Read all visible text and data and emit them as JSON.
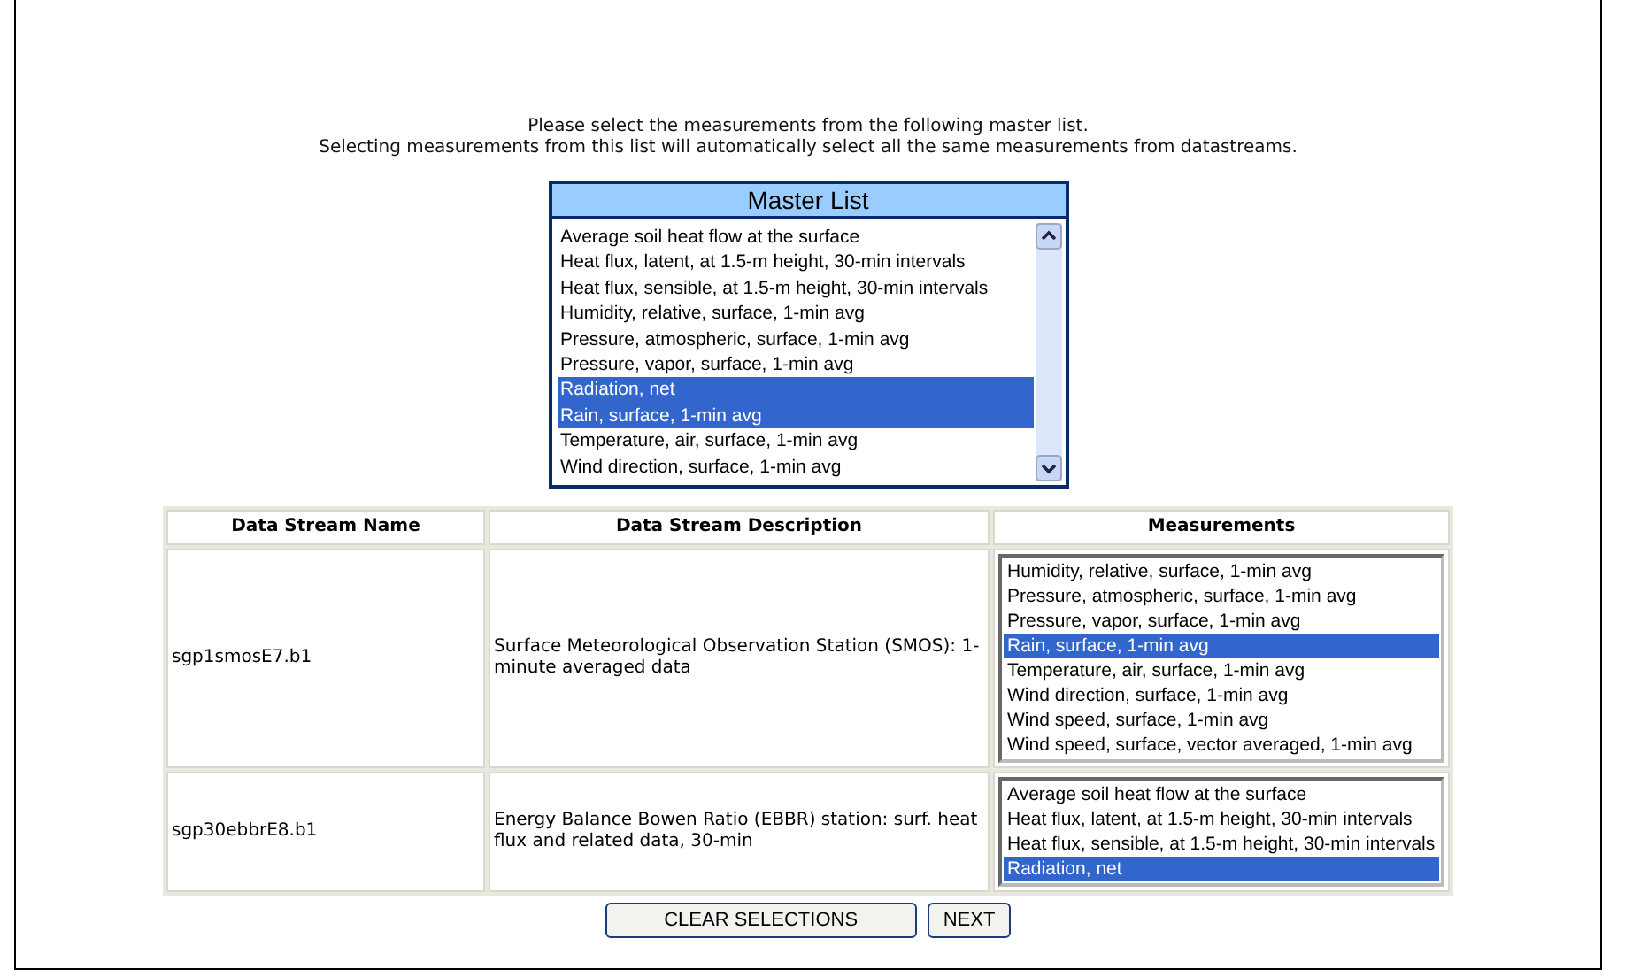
{
  "instructions": [
    "Please select the measurements from the following master list.",
    "Selecting measurements from this list will automatically select all the same measurements from datastreams."
  ],
  "master_list": {
    "title": "Master List",
    "items": [
      {
        "label": "Average soil heat flow at the surface",
        "selected": false
      },
      {
        "label": "Heat flux, latent, at 1.5-m height, 30-min intervals",
        "selected": false
      },
      {
        "label": "Heat flux, sensible, at 1.5-m height, 30-min intervals",
        "selected": false
      },
      {
        "label": "Humidity, relative, surface, 1-min avg",
        "selected": false
      },
      {
        "label": "Pressure, atmospheric, surface, 1-min avg",
        "selected": false
      },
      {
        "label": "Pressure, vapor, surface, 1-min avg",
        "selected": false
      },
      {
        "label": "Radiation, net",
        "selected": true
      },
      {
        "label": "Rain, surface, 1-min avg",
        "selected": true
      },
      {
        "label": "Temperature, air, surface, 1-min avg",
        "selected": false
      },
      {
        "label": "Wind direction, surface, 1-min avg",
        "selected": false
      }
    ]
  },
  "table": {
    "columns": [
      "Data Stream Name",
      "Data Stream Description",
      "Measurements"
    ],
    "rows": [
      {
        "name": "sgp1smosE7.b1",
        "description": "Surface Meteorological Observation Station (SMOS): 1-minute averaged data",
        "measurements": [
          {
            "label": "Humidity, relative, surface, 1-min avg",
            "selected": false
          },
          {
            "label": "Pressure, atmospheric, surface, 1-min avg",
            "selected": false
          },
          {
            "label": "Pressure, vapor, surface, 1-min avg",
            "selected": false
          },
          {
            "label": "Rain, surface, 1-min avg",
            "selected": true
          },
          {
            "label": "Temperature, air, surface, 1-min avg",
            "selected": false
          },
          {
            "label": "Wind direction, surface, 1-min avg",
            "selected": false
          },
          {
            "label": "Wind speed, surface, 1-min avg",
            "selected": false
          },
          {
            "label": "Wind speed, surface, vector averaged, 1-min avg",
            "selected": false
          }
        ]
      },
      {
        "name": "sgp30ebbrE8.b1",
        "description": "Energy Balance Bowen Ratio (EBBR) station: surf. heat flux and related data, 30-min",
        "measurements": [
          {
            "label": "Average soil heat flow at the surface",
            "selected": false
          },
          {
            "label": "Heat flux, latent, at 1.5-m height, 30-min intervals",
            "selected": false
          },
          {
            "label": "Heat flux, sensible, at 1.5-m height, 30-min intervals",
            "selected": false
          },
          {
            "label": "Radiation, net",
            "selected": true
          }
        ]
      }
    ]
  },
  "buttons": [
    "CLEAR SELECTIONS",
    "NEXT"
  ]
}
